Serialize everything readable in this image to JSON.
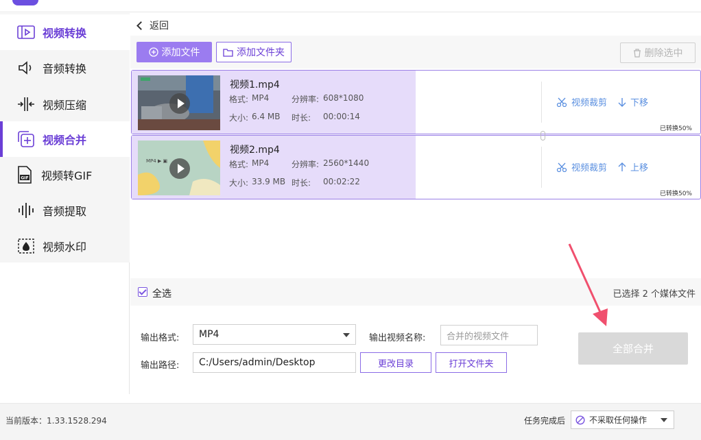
{
  "sidebar": {
    "items": [
      {
        "label": "视频转换",
        "icon": "video-convert-icon"
      },
      {
        "label": "音频转换",
        "icon": "audio-convert-icon"
      },
      {
        "label": "视频压缩",
        "icon": "compress-icon"
      },
      {
        "label": "视频合并",
        "icon": "merge-icon"
      },
      {
        "label": "视频转GIF",
        "icon": "gif-icon"
      },
      {
        "label": "音频提取",
        "icon": "audio-extract-icon"
      },
      {
        "label": "视频水印",
        "icon": "watermark-icon"
      }
    ]
  },
  "header": {
    "back_label": "返回"
  },
  "toolbar": {
    "add_file": "添加文件",
    "add_folder": "添加文件夹",
    "delete_selected": "删除选中"
  },
  "files": [
    {
      "name": "视频1.mp4",
      "format_label": "格式:",
      "format": "MP4",
      "res_label": "分辨率:",
      "resolution": "608*1080",
      "size_label": "大小:",
      "size": "6.4 MB",
      "dur_label": "时长:",
      "duration": "00:00:14",
      "crop": "视频裁剪",
      "move": "下移",
      "move_dir": "down",
      "progress_text": "已转换50%",
      "progress": 0.5
    },
    {
      "name": "视频2.mp4",
      "format_label": "格式:",
      "format": "MP4",
      "res_label": "分辨率:",
      "resolution": "2560*1440",
      "size_label": "大小:",
      "size": "33.9 MB",
      "dur_label": "时长:",
      "duration": "00:02:22",
      "crop": "视频裁剪",
      "move": "上移",
      "move_dir": "up",
      "progress_text": "已转换50%",
      "progress": 0.5
    }
  ],
  "selection": {
    "select_all": "全选",
    "count_text": "已选择 2 个媒体文件"
  },
  "output": {
    "format_label": "输出格式:",
    "format_value": "MP4",
    "name_label": "输出视频名称:",
    "name_placeholder": "合并的视频文件",
    "path_label": "输出路径:",
    "path_value": "C:/Users/admin/Desktop",
    "change_dir": "更改目录",
    "open_folder": "打开文件夹",
    "merge_all": "全部合并"
  },
  "footer": {
    "version": "当前版本：1.33.1528.294",
    "after_label": "任务完成后",
    "after_value": "不采取任何操作"
  },
  "colors": {
    "accent": "#6b3fd6",
    "progress_fill": "#e6dcfa",
    "link": "#5a8fe0",
    "annotation_arrow": "#f0506e"
  }
}
